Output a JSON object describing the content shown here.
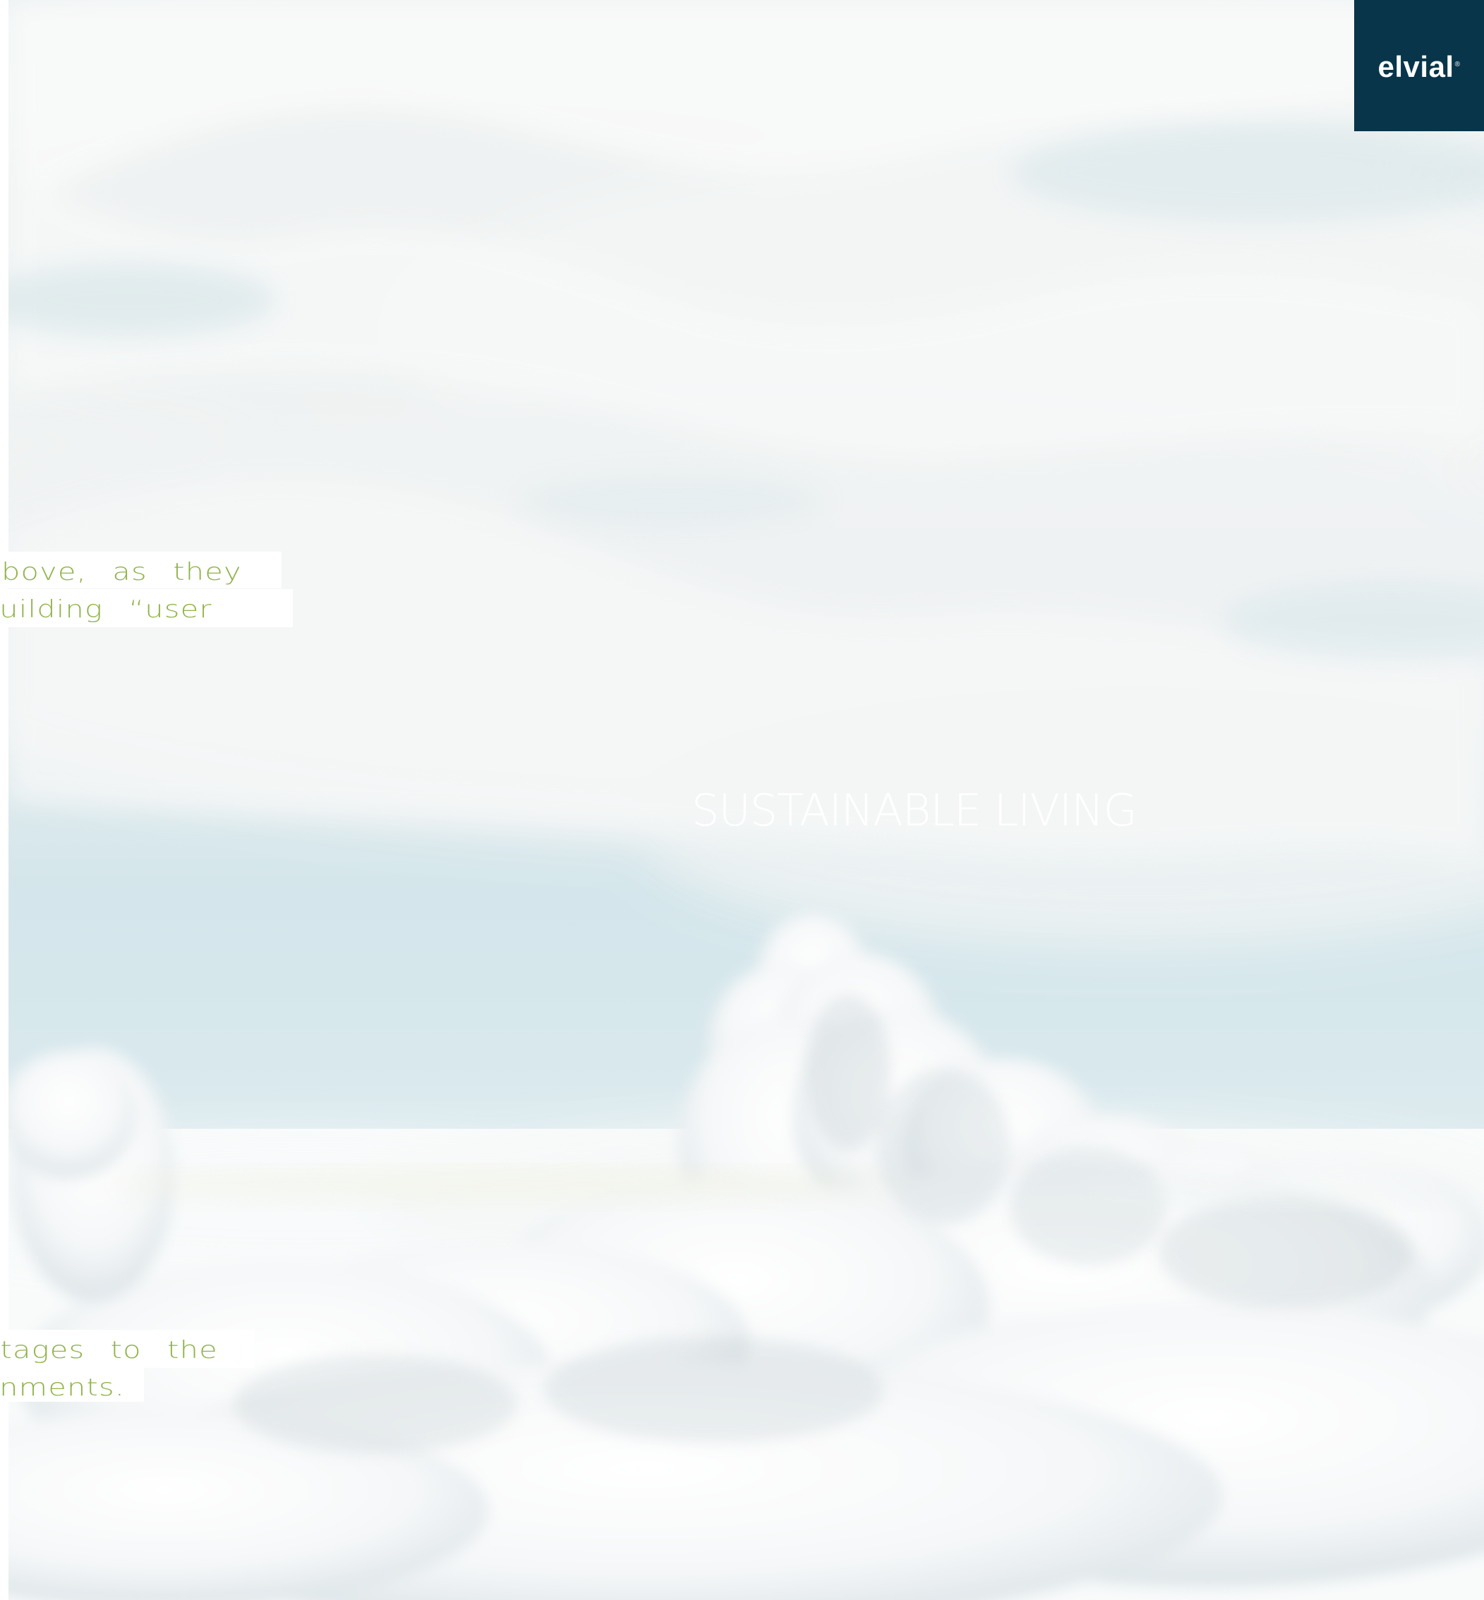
{
  "brand": {
    "logo_text": "elvial",
    "logo_mark": "®",
    "logo_bg": "#08354a",
    "logo_fg": "#ffffff"
  },
  "headline": {
    "text": "SUSTAINABLE LIVING"
  },
  "text_fragments": {
    "top_line_1": "e above, as they",
    "top_line_2": "a building “user",
    "bottom_line_1": "vantages to the",
    "bottom_line_2": "ronments."
  },
  "colors": {
    "accent_green": "#8fb349",
    "sky_blue": "#d4e6eb",
    "cloud_white": "#ffffff"
  },
  "icons": {
    "background_image": "cloudscape"
  }
}
